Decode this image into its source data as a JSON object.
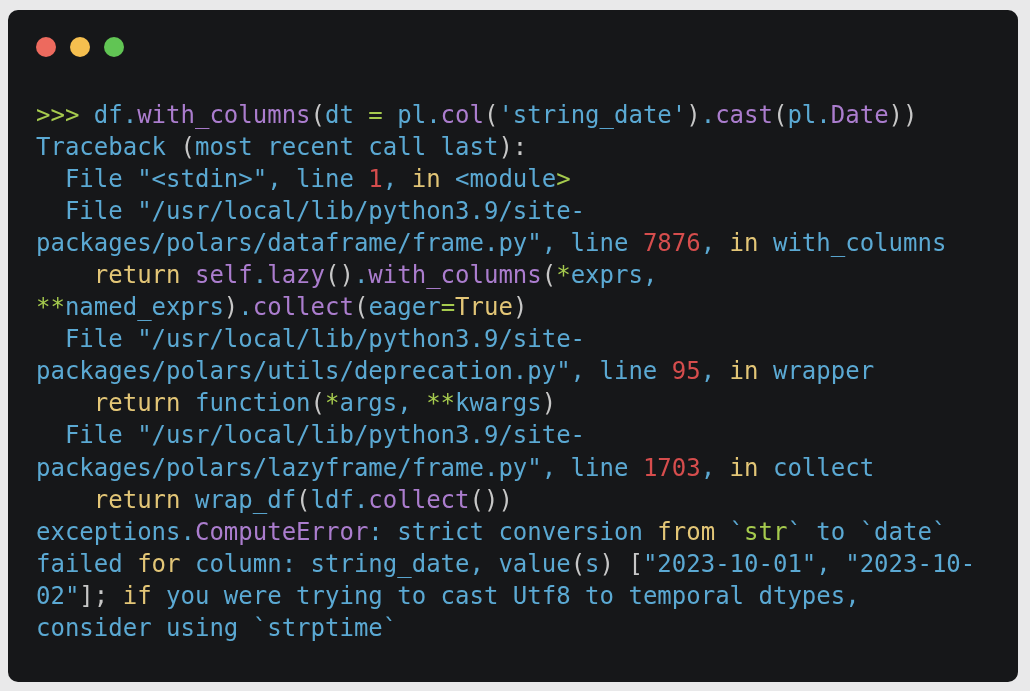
{
  "window": {
    "controls": [
      {
        "color": "#ed6a5e"
      },
      {
        "color": "#f5bf4f"
      },
      {
        "color": "#61c554"
      }
    ]
  },
  "code": {
    "lines": [
      [
        {
          "text": ">>>",
          "kind": "op"
        },
        {
          "text": " df.",
          "kind": "plain"
        },
        {
          "text": "with_columns",
          "kind": "fn"
        },
        {
          "text": "(",
          "kind": "punct"
        },
        {
          "text": "dt ",
          "kind": "plain"
        },
        {
          "text": "=",
          "kind": "op"
        },
        {
          "text": " pl.",
          "kind": "plain"
        },
        {
          "text": "col",
          "kind": "fn"
        },
        {
          "text": "(",
          "kind": "punct"
        },
        {
          "text": "'string_date'",
          "kind": "plain"
        },
        {
          "text": ")",
          "kind": "punct"
        },
        {
          "text": ".",
          "kind": "plain"
        },
        {
          "text": "cast",
          "kind": "fn"
        },
        {
          "text": "(",
          "kind": "punct"
        },
        {
          "text": "pl.",
          "kind": "plain"
        },
        {
          "text": "Date",
          "kind": "fn"
        },
        {
          "text": "))",
          "kind": "punct"
        }
      ],
      [
        {
          "text": "Traceback ",
          "kind": "plain"
        },
        {
          "text": "(",
          "kind": "punct"
        },
        {
          "text": "most recent call last",
          "kind": "plain"
        },
        {
          "text": "):",
          "kind": "punct"
        }
      ],
      [
        {
          "text": "  File \"<stdin>\", line ",
          "kind": "plain"
        },
        {
          "text": "1",
          "kind": "num"
        },
        {
          "text": ", ",
          "kind": "plain"
        },
        {
          "text": "in",
          "kind": "kw"
        },
        {
          "text": " <module",
          "kind": "plain"
        },
        {
          "text": ">",
          "kind": "op"
        }
      ],
      [
        {
          "text": "  File \"/usr/local/lib/python3.9/site-",
          "kind": "plain"
        }
      ],
      [
        {
          "text": "packages/polars/dataframe/frame.py\", line ",
          "kind": "plain"
        },
        {
          "text": "7876",
          "kind": "num"
        },
        {
          "text": ", ",
          "kind": "plain"
        },
        {
          "text": "in",
          "kind": "kw"
        },
        {
          "text": " with_columns",
          "kind": "plain"
        }
      ],
      [
        {
          "text": "    return ",
          "kind": "kw"
        },
        {
          "text": "self",
          "kind": "fn"
        },
        {
          "text": ".",
          "kind": "plain"
        },
        {
          "text": "lazy",
          "kind": "fn"
        },
        {
          "text": "()",
          "kind": "punct"
        },
        {
          "text": ".",
          "kind": "plain"
        },
        {
          "text": "with_columns",
          "kind": "fn"
        },
        {
          "text": "(",
          "kind": "punct"
        },
        {
          "text": "*",
          "kind": "op"
        },
        {
          "text": "exprs,",
          "kind": "plain"
        }
      ],
      [
        {
          "text": "**",
          "kind": "op"
        },
        {
          "text": "named_exprs",
          "kind": "plain"
        },
        {
          "text": ")",
          "kind": "punct"
        },
        {
          "text": ".",
          "kind": "plain"
        },
        {
          "text": "collect",
          "kind": "fn"
        },
        {
          "text": "(",
          "kind": "punct"
        },
        {
          "text": "eager",
          "kind": "plain"
        },
        {
          "text": "=",
          "kind": "op"
        },
        {
          "text": "True",
          "kind": "kw"
        },
        {
          "text": ")",
          "kind": "punct"
        }
      ],
      [
        {
          "text": "  File \"/usr/local/lib/python3.9/site-",
          "kind": "plain"
        }
      ],
      [
        {
          "text": "packages/polars/utils/deprecation.py\", line ",
          "kind": "plain"
        },
        {
          "text": "95",
          "kind": "num"
        },
        {
          "text": ", ",
          "kind": "plain"
        },
        {
          "text": "in",
          "kind": "kw"
        },
        {
          "text": " wrapper",
          "kind": "plain"
        }
      ],
      [
        {
          "text": "    return",
          "kind": "kw"
        },
        {
          "text": " function",
          "kind": "plain"
        },
        {
          "text": "(",
          "kind": "punct"
        },
        {
          "text": "*",
          "kind": "op"
        },
        {
          "text": "args, ",
          "kind": "plain"
        },
        {
          "text": "**",
          "kind": "op"
        },
        {
          "text": "kwargs",
          "kind": "plain"
        },
        {
          "text": ")",
          "kind": "punct"
        }
      ],
      [
        {
          "text": "  File \"/usr/local/lib/python3.9/site-",
          "kind": "plain"
        }
      ],
      [
        {
          "text": "packages/polars/lazyframe/frame.py\", line ",
          "kind": "plain"
        },
        {
          "text": "1703",
          "kind": "num"
        },
        {
          "text": ", ",
          "kind": "plain"
        },
        {
          "text": "in",
          "kind": "kw"
        },
        {
          "text": " collect",
          "kind": "plain"
        }
      ],
      [
        {
          "text": "    return",
          "kind": "kw"
        },
        {
          "text": " wrap_df",
          "kind": "plain"
        },
        {
          "text": "(",
          "kind": "punct"
        },
        {
          "text": "ldf.",
          "kind": "plain"
        },
        {
          "text": "collect",
          "kind": "fn"
        },
        {
          "text": "())",
          "kind": "punct"
        }
      ],
      [
        {
          "text": "exceptions.",
          "kind": "plain"
        },
        {
          "text": "ComputeError",
          "kind": "fn"
        },
        {
          "text": ": strict conversion ",
          "kind": "plain"
        },
        {
          "text": "from",
          "kind": "kw"
        },
        {
          "text": " `",
          "kind": "plain"
        },
        {
          "text": "str",
          "kind": "op"
        },
        {
          "text": "` to `date`",
          "kind": "plain"
        }
      ],
      [
        {
          "text": "failed ",
          "kind": "plain"
        },
        {
          "text": "for",
          "kind": "kw"
        },
        {
          "text": " column: string_date, value",
          "kind": "plain"
        },
        {
          "text": "(",
          "kind": "punct"
        },
        {
          "text": "s",
          "kind": "plain"
        },
        {
          "text": ") [",
          "kind": "punct"
        },
        {
          "text": "\"2023-10-01\", \"2023-10-",
          "kind": "plain"
        }
      ],
      [
        {
          "text": "02\"",
          "kind": "plain"
        },
        {
          "text": "];",
          "kind": "punct"
        },
        {
          "text": " if",
          "kind": "kw"
        },
        {
          "text": " you were trying to cast Utf8 to temporal dtypes,",
          "kind": "plain"
        }
      ],
      [
        {
          "text": "consider using `strptime`",
          "kind": "plain"
        }
      ]
    ]
  }
}
